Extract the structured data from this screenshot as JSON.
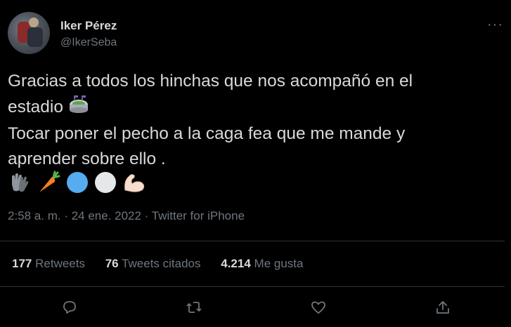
{
  "author": {
    "name": "Iker Pérez",
    "handle": "@IkerSeba"
  },
  "more_label": "···",
  "tweet": {
    "line1": "Gracias a todos los hinchas que nos acompañó en el",
    "line2": "estadio",
    "line3": "Tocar poner el pecho a la caga fea que me mande y",
    "line4": "aprender sobre ello ."
  },
  "meta": "2:58 a. m. · 24 ene. 2022 · Twitter for iPhone",
  "stats": {
    "retweets_count": "177",
    "retweets_label": "Retweets",
    "quotes_count": "76",
    "quotes_label": "Tweets citados",
    "likes_count": "4.214",
    "likes_label": "Me gusta"
  },
  "icons": {
    "reply": "reply-icon",
    "retweet": "retweet-icon",
    "like": "heart-icon",
    "share": "share-icon"
  },
  "colors": {
    "background": "#000000",
    "text": "#d9d9d9",
    "secondary": "#6e767d",
    "divider": "#2f3336"
  }
}
